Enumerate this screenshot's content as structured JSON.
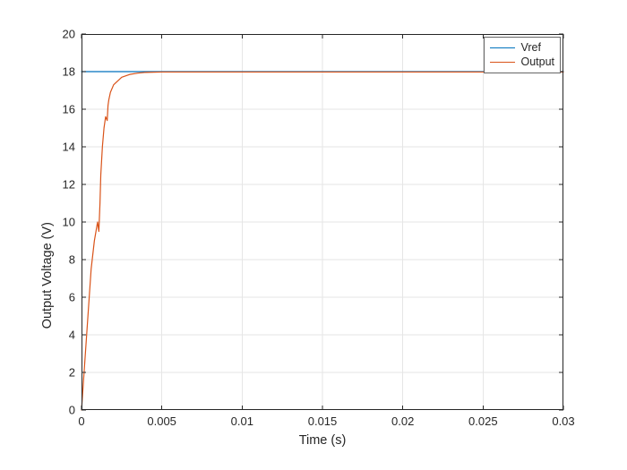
{
  "chart_data": {
    "type": "line",
    "title": "",
    "xlabel": "Time (s)",
    "ylabel": "Output Voltage (V)",
    "xlim": [
      0,
      0.03
    ],
    "ylim": [
      0,
      20
    ],
    "xticks": [
      0,
      0.005,
      0.01,
      0.015,
      0.02,
      0.025,
      0.03
    ],
    "yticks": [
      0,
      2,
      4,
      6,
      8,
      10,
      12,
      14,
      16,
      18,
      20
    ],
    "grid": true,
    "legend_position": "upper-right",
    "series": [
      {
        "name": "Vref",
        "color": "#0072BD",
        "x": [
          0,
          0.03
        ],
        "values": [
          18,
          18
        ]
      },
      {
        "name": "Output",
        "color": "#D95319",
        "x": [
          0,
          0.0002,
          0.0004,
          0.0006,
          0.0008,
          0.001,
          0.00108,
          0.00115,
          0.0012,
          0.0013,
          0.0014,
          0.0015,
          0.0016,
          0.00165,
          0.0017,
          0.0018,
          0.002,
          0.0025,
          0.003,
          0.0035,
          0.004,
          0.005,
          0.0075,
          0.01,
          0.015,
          0.02,
          0.025,
          0.03
        ],
        "values": [
          0,
          2.5,
          5.0,
          7.5,
          9.0,
          10.0,
          9.5,
          11.0,
          12.5,
          14.0,
          15.0,
          15.6,
          15.4,
          16.2,
          16.5,
          16.9,
          17.3,
          17.7,
          17.85,
          17.92,
          17.96,
          17.98,
          17.98,
          17.98,
          17.98,
          17.98,
          17.98,
          17.98
        ]
      }
    ]
  },
  "legend": {
    "items": [
      {
        "label": "Vref"
      },
      {
        "label": "Output"
      }
    ]
  },
  "axes": {
    "xlabel": "Time (s)",
    "ylabel": "Output Voltage (V)",
    "xticklabels": [
      "0",
      "0.005",
      "0.01",
      "0.015",
      "0.02",
      "0.025",
      "0.03"
    ],
    "yticklabels": [
      "0",
      "2",
      "4",
      "6",
      "8",
      "10",
      "12",
      "14",
      "16",
      "18",
      "20"
    ]
  }
}
